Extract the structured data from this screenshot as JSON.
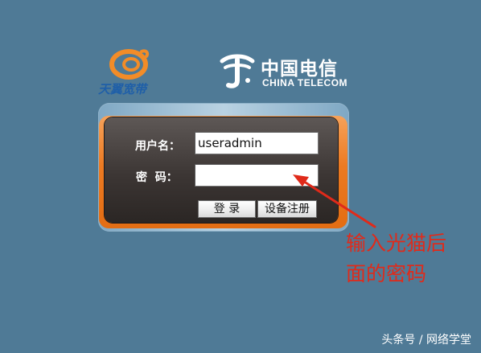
{
  "logos": {
    "tianyi_text": "天翼宽带",
    "telecom_cn": "中国电信",
    "telecom_en": "CHINA TELECOM"
  },
  "login": {
    "username_label": "用户名：",
    "password_label": "密  码：",
    "username_value": "useradmin",
    "password_value": "",
    "login_button": "登 录",
    "register_button": "设备注册"
  },
  "annotation": {
    "line1": "输入光猫后",
    "line2": "面的密码",
    "color": "#e02a1a"
  },
  "watermark": "头条号 / 网络学堂",
  "colors": {
    "background": "#4f7a96",
    "panel_dark": "#3c3634",
    "panel_orange": "#ec7a22",
    "tianyi_blue": "#1f5fa8",
    "tianyi_orange": "#f28c28"
  }
}
